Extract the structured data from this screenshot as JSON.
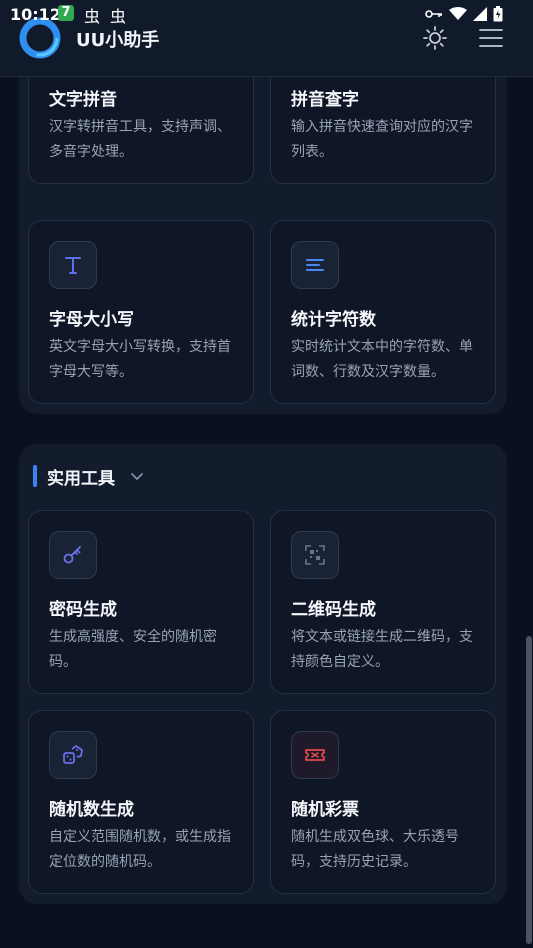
{
  "status": {
    "time": "10:12",
    "badge": "7",
    "bug_icon": "虫",
    "right_icons": [
      "key-icon",
      "wifi-icon",
      "signal-icon",
      "battery-icon"
    ]
  },
  "header": {
    "title": "UU小助手",
    "logo_icon": "app-logo",
    "theme_icon": "sun-icon",
    "menu_icon": "menu-icon"
  },
  "section_text": {
    "cards": [
      {
        "title": "文字拼音",
        "desc": "汉字转拼音工具，支持声调、多音字处理。"
      },
      {
        "title": "拼音查字",
        "desc": "输入拼音快速查询对应的汉字列表。"
      },
      {
        "title": "字母大小写",
        "desc": "英文字母大小写转换，支持首字母大写等。",
        "icon": "letter-t-icon"
      },
      {
        "title": "统计字符数",
        "desc": "实时统计文本中的字符数、单词数、行数及汉字数量。",
        "icon": "text-lines-icon"
      }
    ]
  },
  "section_tools": {
    "title": "实用工具",
    "cards": [
      {
        "title": "密码生成",
        "desc": "生成高强度、安全的随机密码。",
        "icon": "key-icon"
      },
      {
        "title": "二维码生成",
        "desc": "将文本或链接生成二维码，支持颜色自定义。",
        "icon": "qrcode-icon"
      },
      {
        "title": "随机数生成",
        "desc": "自定义范围随机数，或生成指定位数的随机码。",
        "icon": "dice-icon"
      },
      {
        "title": "随机彩票",
        "desc": "随机生成双色球、大乐透号码，支持历史记录。",
        "icon": "ticket-icon"
      }
    ]
  },
  "colors": {
    "accent": "#3b82f6",
    "background": "#0a1020",
    "card": "#0f1626"
  }
}
